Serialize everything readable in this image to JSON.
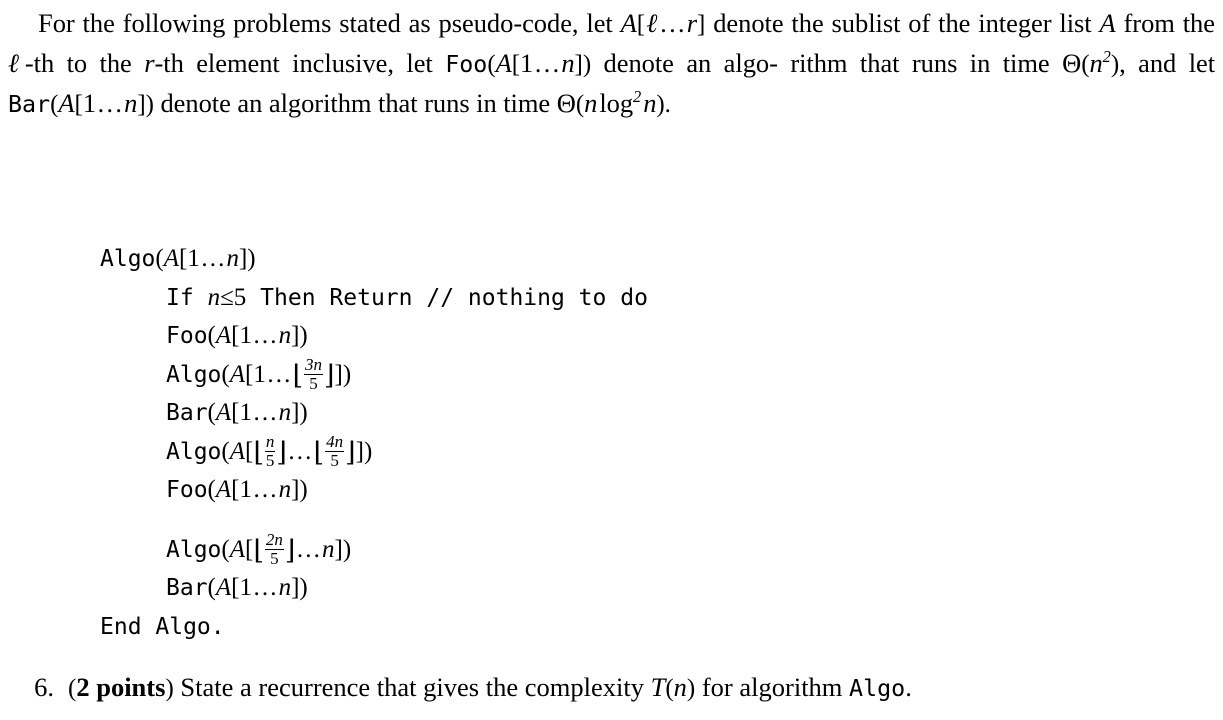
{
  "document": {
    "intro": {
      "lead_in": "For the following problems stated as pseudo-code, let",
      "sublist_var": "A",
      "sublist_range_l": "ℓ",
      "sublist_range_r": "r",
      "after_sublist": "denote the sublist of the",
      "line2_a": "integer list",
      "list_var": "A",
      "line2_b": "from the",
      "ell": "ℓ",
      "line2_c": "-th to the",
      "r_var": "r",
      "line2_d": "-th element inclusive, let",
      "foo_name": "Foo",
      "foo_arg_a": "A",
      "foo_arg_1": "1",
      "foo_arg_n": "n",
      "line2_e": "denote an algo-",
      "line3_a": "rithm that runs in time",
      "theta": "Θ",
      "n_var": "n",
      "exp2": "2",
      "line3_b": ", and let",
      "bar_name": "Bar",
      "line3_c": "denote an algorithm that runs in time",
      "line4_theta": "Θ",
      "line4_n": "n",
      "line4_log": "log",
      "line4_exp": "2",
      "line4_n2": "n",
      "line4_period": ")."
    },
    "pseudocode": {
      "lines": [
        {
          "indent": 0,
          "call": "Algo",
          "arg": "A[1…n]",
          "id": "algo-signature"
        },
        {
          "indent": 1,
          "keyword_if": "If",
          "condition_var": "n",
          "condition_op": "≤",
          "condition_val": "5",
          "keyword_then": "Then",
          "keyword_return": "Return",
          "comment": "// nothing to do",
          "id": "if-return-line"
        },
        {
          "indent": 1,
          "call": "Foo",
          "arg": "A[1…n]",
          "id": "foo-call-1"
        },
        {
          "indent": 1,
          "call": "Algo",
          "arg": "A[1…⌊3n/5⌋]",
          "frac_num": "3n",
          "frac_den": "5",
          "id": "algo-call-1"
        },
        {
          "indent": 1,
          "call": "Bar",
          "arg": "A[1…n]",
          "id": "bar-call-1"
        },
        {
          "indent": 1,
          "call": "Algo",
          "arg": "A[⌊n/5⌋…⌊4n/5⌋]",
          "frac1_num": "n",
          "frac1_den": "5",
          "frac2_num": "4n",
          "frac2_den": "5",
          "id": "algo-call-2"
        },
        {
          "indent": 1,
          "call": "Foo",
          "arg": "A[1…n]",
          "id": "foo-call-2"
        },
        {
          "indent": 1,
          "call": "Algo",
          "arg": "A[⌊2n/5⌋…n]",
          "frac_num": "2n",
          "frac_den": "5",
          "id": "algo-call-3"
        },
        {
          "indent": 1,
          "call": "Bar",
          "arg": "A[1…n]",
          "id": "bar-call-2"
        },
        {
          "indent": 0,
          "call": "End Algo.",
          "id": "algo-end"
        }
      ]
    },
    "question": {
      "number": "6.",
      "points": "2 points",
      "text_before": "State a recurrence that gives the complexity",
      "complexity_T": "T",
      "complexity_n": "n",
      "text_after": "for algorithm",
      "algo_name": "Algo",
      "period": "."
    },
    "symbols": {
      "ellipsis": "…",
      "floor_left": "⌊",
      "floor_right": "⌋",
      "bracket_left": "[",
      "bracket_right": "]",
      "paren_left": "(",
      "paren_right": ")",
      "leq": "≤",
      "theta": "Θ"
    },
    "colors": {
      "background": "#ffffff",
      "text": "#000000"
    }
  }
}
